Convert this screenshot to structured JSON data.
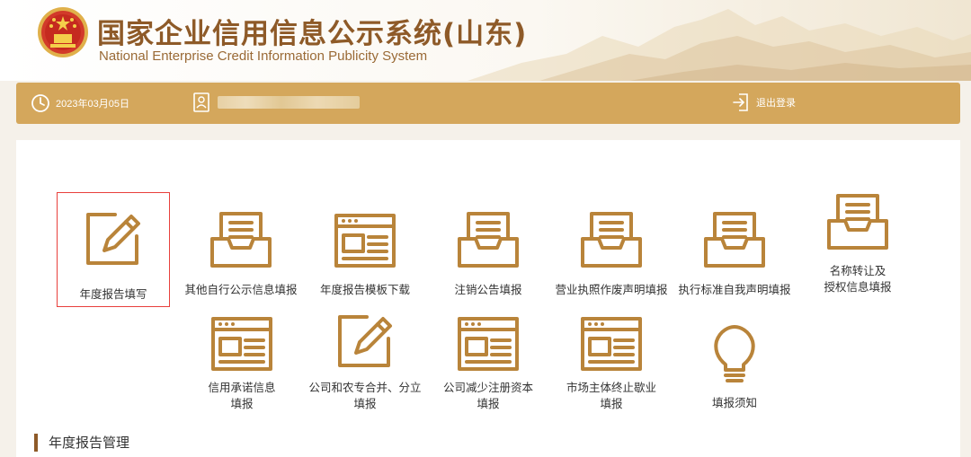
{
  "header": {
    "title_cn": "国家企业信用信息公示系统(山东)",
    "title_en": "National Enterprise Credit Information Publicity System"
  },
  "toolbar": {
    "date": "2023年03月05日",
    "logout_label": "退出登录"
  },
  "menu": {
    "items": [
      {
        "label": "年度报告填写",
        "icon": "edit-icon"
      },
      {
        "label": "其他自行公示信息填报",
        "icon": "inbox-icon"
      },
      {
        "label": "年度报告模板下载",
        "icon": "window-icon"
      },
      {
        "label": "注销公告填报",
        "icon": "inbox-icon"
      },
      {
        "label": "营业执照作废声明填报",
        "icon": "inbox-icon"
      },
      {
        "label": "执行标准自我声明填报",
        "icon": "inbox-icon"
      },
      {
        "label_line1": "名称转让及",
        "label_line2": "授权信息填报",
        "icon": "inbox-icon"
      },
      {
        "label_line1": "信用承诺信息",
        "label_line2": "填报",
        "icon": "window-icon"
      },
      {
        "label": "公司和农专合并、分立",
        "label_line2": "填报",
        "icon": "edit-icon"
      },
      {
        "label": "公司减少注册资本",
        "label_line2": "填报",
        "icon": "window-icon"
      },
      {
        "label": "市场主体终止歇业",
        "label_line2": "填报",
        "icon": "window-icon"
      },
      {
        "label": "填报须知",
        "icon": "lightbulb-icon"
      }
    ],
    "selected_index": 0
  },
  "section": {
    "title": "年度报告管理"
  },
  "colors": {
    "accent": "#d4a75c",
    "brown": "#8e5a28",
    "icon": "#b9843a",
    "highlight": "#e8403c"
  }
}
